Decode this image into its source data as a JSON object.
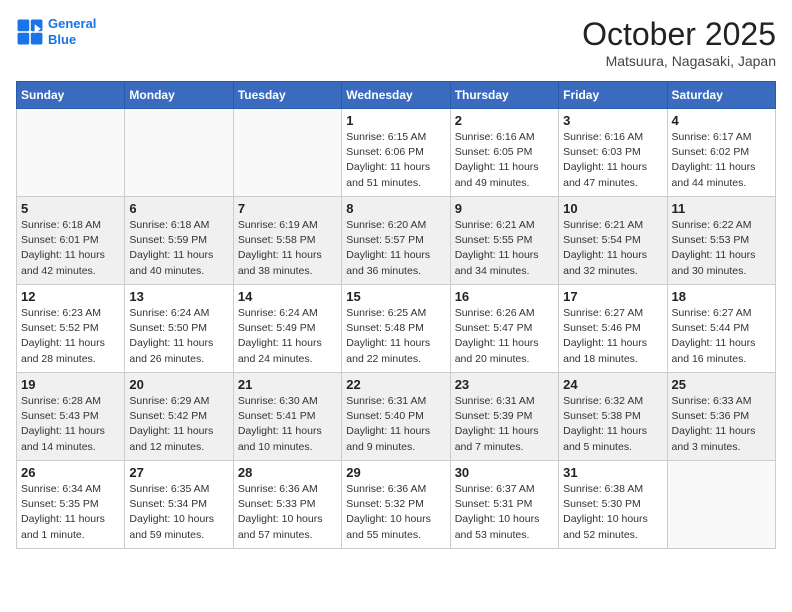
{
  "header": {
    "logo_line1": "General",
    "logo_line2": "Blue",
    "month": "October 2025",
    "location": "Matsuura, Nagasaki, Japan"
  },
  "weekdays": [
    "Sunday",
    "Monday",
    "Tuesday",
    "Wednesday",
    "Thursday",
    "Friday",
    "Saturday"
  ],
  "weeks": [
    [
      {
        "day": "",
        "info": ""
      },
      {
        "day": "",
        "info": ""
      },
      {
        "day": "",
        "info": ""
      },
      {
        "day": "1",
        "info": "Sunrise: 6:15 AM\nSunset: 6:06 PM\nDaylight: 11 hours\nand 51 minutes."
      },
      {
        "day": "2",
        "info": "Sunrise: 6:16 AM\nSunset: 6:05 PM\nDaylight: 11 hours\nand 49 minutes."
      },
      {
        "day": "3",
        "info": "Sunrise: 6:16 AM\nSunset: 6:03 PM\nDaylight: 11 hours\nand 47 minutes."
      },
      {
        "day": "4",
        "info": "Sunrise: 6:17 AM\nSunset: 6:02 PM\nDaylight: 11 hours\nand 44 minutes."
      }
    ],
    [
      {
        "day": "5",
        "info": "Sunrise: 6:18 AM\nSunset: 6:01 PM\nDaylight: 11 hours\nand 42 minutes."
      },
      {
        "day": "6",
        "info": "Sunrise: 6:18 AM\nSunset: 5:59 PM\nDaylight: 11 hours\nand 40 minutes."
      },
      {
        "day": "7",
        "info": "Sunrise: 6:19 AM\nSunset: 5:58 PM\nDaylight: 11 hours\nand 38 minutes."
      },
      {
        "day": "8",
        "info": "Sunrise: 6:20 AM\nSunset: 5:57 PM\nDaylight: 11 hours\nand 36 minutes."
      },
      {
        "day": "9",
        "info": "Sunrise: 6:21 AM\nSunset: 5:55 PM\nDaylight: 11 hours\nand 34 minutes."
      },
      {
        "day": "10",
        "info": "Sunrise: 6:21 AM\nSunset: 5:54 PM\nDaylight: 11 hours\nand 32 minutes."
      },
      {
        "day": "11",
        "info": "Sunrise: 6:22 AM\nSunset: 5:53 PM\nDaylight: 11 hours\nand 30 minutes."
      }
    ],
    [
      {
        "day": "12",
        "info": "Sunrise: 6:23 AM\nSunset: 5:52 PM\nDaylight: 11 hours\nand 28 minutes."
      },
      {
        "day": "13",
        "info": "Sunrise: 6:24 AM\nSunset: 5:50 PM\nDaylight: 11 hours\nand 26 minutes."
      },
      {
        "day": "14",
        "info": "Sunrise: 6:24 AM\nSunset: 5:49 PM\nDaylight: 11 hours\nand 24 minutes."
      },
      {
        "day": "15",
        "info": "Sunrise: 6:25 AM\nSunset: 5:48 PM\nDaylight: 11 hours\nand 22 minutes."
      },
      {
        "day": "16",
        "info": "Sunrise: 6:26 AM\nSunset: 5:47 PM\nDaylight: 11 hours\nand 20 minutes."
      },
      {
        "day": "17",
        "info": "Sunrise: 6:27 AM\nSunset: 5:46 PM\nDaylight: 11 hours\nand 18 minutes."
      },
      {
        "day": "18",
        "info": "Sunrise: 6:27 AM\nSunset: 5:44 PM\nDaylight: 11 hours\nand 16 minutes."
      }
    ],
    [
      {
        "day": "19",
        "info": "Sunrise: 6:28 AM\nSunset: 5:43 PM\nDaylight: 11 hours\nand 14 minutes."
      },
      {
        "day": "20",
        "info": "Sunrise: 6:29 AM\nSunset: 5:42 PM\nDaylight: 11 hours\nand 12 minutes."
      },
      {
        "day": "21",
        "info": "Sunrise: 6:30 AM\nSunset: 5:41 PM\nDaylight: 11 hours\nand 10 minutes."
      },
      {
        "day": "22",
        "info": "Sunrise: 6:31 AM\nSunset: 5:40 PM\nDaylight: 11 hours\nand 9 minutes."
      },
      {
        "day": "23",
        "info": "Sunrise: 6:31 AM\nSunset: 5:39 PM\nDaylight: 11 hours\nand 7 minutes."
      },
      {
        "day": "24",
        "info": "Sunrise: 6:32 AM\nSunset: 5:38 PM\nDaylight: 11 hours\nand 5 minutes."
      },
      {
        "day": "25",
        "info": "Sunrise: 6:33 AM\nSunset: 5:36 PM\nDaylight: 11 hours\nand 3 minutes."
      }
    ],
    [
      {
        "day": "26",
        "info": "Sunrise: 6:34 AM\nSunset: 5:35 PM\nDaylight: 11 hours\nand 1 minute."
      },
      {
        "day": "27",
        "info": "Sunrise: 6:35 AM\nSunset: 5:34 PM\nDaylight: 10 hours\nand 59 minutes."
      },
      {
        "day": "28",
        "info": "Sunrise: 6:36 AM\nSunset: 5:33 PM\nDaylight: 10 hours\nand 57 minutes."
      },
      {
        "day": "29",
        "info": "Sunrise: 6:36 AM\nSunset: 5:32 PM\nDaylight: 10 hours\nand 55 minutes."
      },
      {
        "day": "30",
        "info": "Sunrise: 6:37 AM\nSunset: 5:31 PM\nDaylight: 10 hours\nand 53 minutes."
      },
      {
        "day": "31",
        "info": "Sunrise: 6:38 AM\nSunset: 5:30 PM\nDaylight: 10 hours\nand 52 minutes."
      },
      {
        "day": "",
        "info": ""
      }
    ]
  ]
}
